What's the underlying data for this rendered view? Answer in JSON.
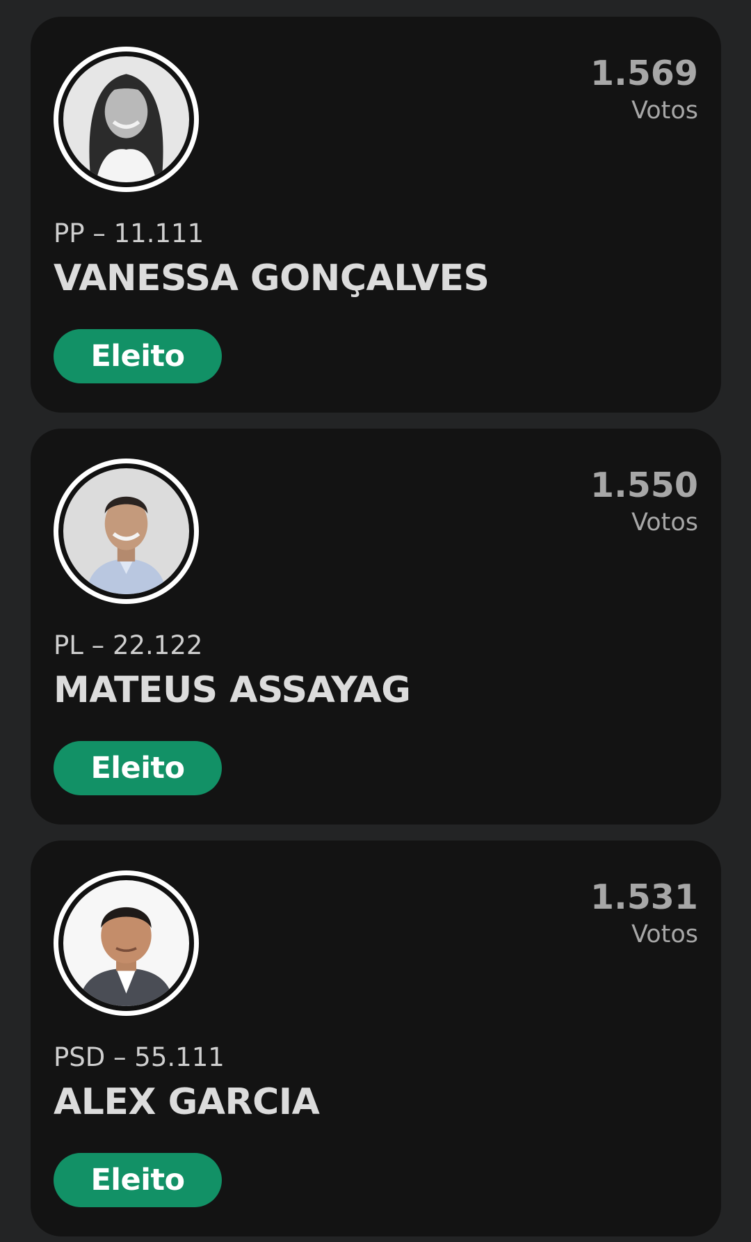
{
  "candidates": [
    {
      "votes": "1.569",
      "votes_label": "Votos",
      "party_line": "PP – 11.111",
      "name": "VANESSA GONÇALVES",
      "status": "Eleito"
    },
    {
      "votes": "1.550",
      "votes_label": "Votos",
      "party_line": "PL – 22.122",
      "name": "MATEUS ASSAYAG",
      "status": "Eleito"
    },
    {
      "votes": "1.531",
      "votes_label": "Votos",
      "party_line": "PSD – 55.111",
      "name": "ALEX GARCIA",
      "status": "Eleito"
    }
  ],
  "colors": {
    "background": "#232425",
    "card": "#131313",
    "status_badge": "#129166",
    "text_primary": "#dcdcdc",
    "text_secondary": "#a7a7a7"
  }
}
